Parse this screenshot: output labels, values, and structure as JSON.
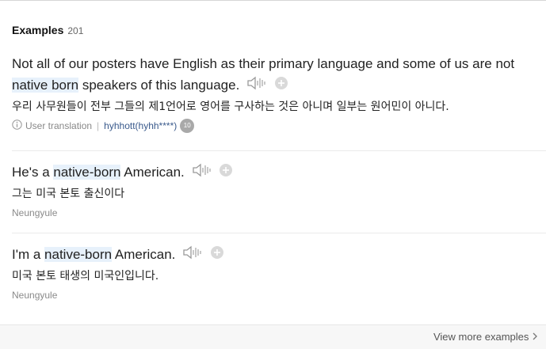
{
  "header": {
    "title": "Examples",
    "count": "201"
  },
  "examples": [
    {
      "en_before": "Not all of our posters have English as their primary language and some of us are not ",
      "en_highlight": "native born",
      "en_after": " speakers of this language.",
      "ko": "우리 사무원들이 전부 그들의 제1언어로 영어를 구사하는 것은 아니며 일부는 원어민이 아니다.",
      "meta_label": "User translation",
      "user": "hyhhott(hyhh****)",
      "badge": "10"
    },
    {
      "en_before": "He's a ",
      "en_highlight": "native-born",
      "en_after": " American.",
      "ko": "그는 미국 본토 출신이다",
      "source": "Neungyule"
    },
    {
      "en_before": "I'm a ",
      "en_highlight": "native-born",
      "en_after": " American.",
      "ko": "미국 본토 태생의 미국인입니다.",
      "source": "Neungyule"
    }
  ],
  "footer": {
    "more_label": "View more examples"
  },
  "icons": {
    "speaker": "speaker-icon",
    "add": "plus-circle-icon",
    "info": "info-circle-icon",
    "chevron": "chevron-right-icon"
  },
  "colors": {
    "highlight": "#e7f1fb",
    "user_link": "#3a5a8c",
    "badge": "#a9a9a9"
  }
}
